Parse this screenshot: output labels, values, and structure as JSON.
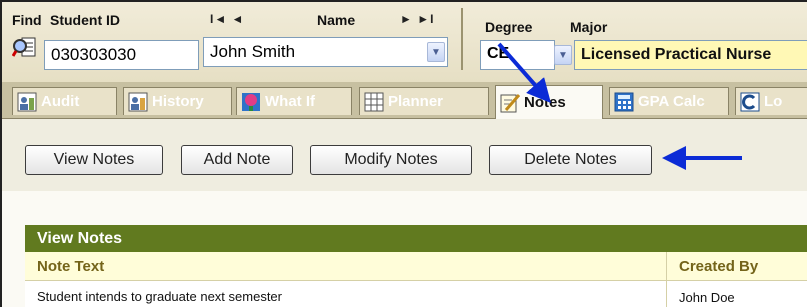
{
  "header": {
    "find_label": "Find",
    "student_id_label": "Student ID",
    "student_id_value": "030303030",
    "nav_first": "I◄  ◄",
    "name_label": "Name",
    "nav_last": "►  ►I",
    "name_value": "John Smith",
    "degree_label": "Degree",
    "degree_value": "CE",
    "major_label": "Major",
    "major_value": "Licensed Practical Nurse"
  },
  "tabs": [
    {
      "label": "Audit",
      "icon": "audit-icon",
      "active": false
    },
    {
      "label": "History",
      "icon": "history-icon",
      "active": false
    },
    {
      "label": "What If",
      "icon": "what-if-icon",
      "active": false
    },
    {
      "label": "Planner",
      "icon": "planner-icon",
      "active": false
    },
    {
      "label": "Notes",
      "icon": "notes-icon",
      "active": true
    },
    {
      "label": "GPA Calc",
      "icon": "calculator-icon",
      "active": false
    },
    {
      "label": "Lo",
      "icon": "logout-icon",
      "active": false
    }
  ],
  "toolbar": {
    "view_notes": "View Notes",
    "add_note": "Add Note",
    "modify_notes": "Modify Notes",
    "delete_notes": "Delete Notes"
  },
  "notes": {
    "title": "View Notes",
    "columns": [
      "Note Text",
      "Created By"
    ],
    "rows": [
      {
        "text": "Student intends to graduate next semester",
        "created_by": "John Doe"
      }
    ]
  },
  "colors": {
    "annotation_arrow": "#0b2bd6",
    "panel_header": "#617a1f",
    "major_highlight": "#fff8b5"
  }
}
